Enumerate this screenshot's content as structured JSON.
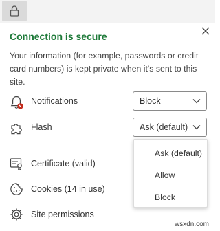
{
  "header": {
    "lock_icon": "lock-icon"
  },
  "panel": {
    "title": "Connection is secure",
    "title_color": "#1e7a39",
    "description": "Your information (for example, passwords or credit card numbers) is kept private when it's sent to this site.",
    "close_icon": "close-icon"
  },
  "permissions": [
    {
      "label": "Notifications",
      "icon": "bell-blocked-icon",
      "value": "Block"
    },
    {
      "label": "Flash",
      "icon": "puzzle-icon",
      "value": "Ask (default)"
    }
  ],
  "links": [
    {
      "label": "Certificate (valid)",
      "icon": "certificate-icon"
    },
    {
      "label": "Cookies (14 in use)",
      "icon": "cookie-icon"
    },
    {
      "label": "Site permissions",
      "icon": "gear-icon"
    }
  ],
  "dropdown": {
    "open_for": "Flash",
    "options": [
      "Ask (default)",
      "Allow",
      "Block"
    ]
  },
  "watermark": "wsxdn.com",
  "colors": {
    "accent_green": "#1e7a39",
    "blocked_red": "#c42b1c"
  }
}
